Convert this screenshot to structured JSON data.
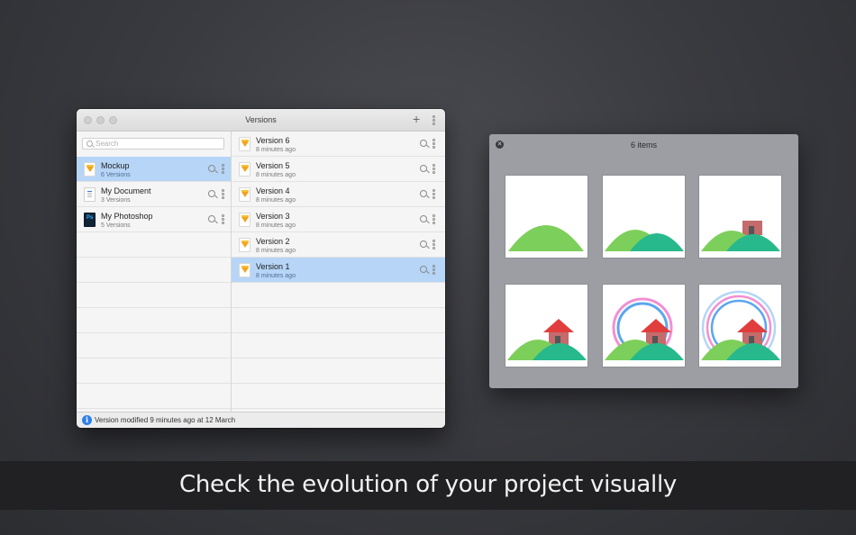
{
  "window": {
    "title": "Versions",
    "add_label": "+",
    "search_placeholder": "Search"
  },
  "documents": [
    {
      "name": "Mockup",
      "versions": "6 Versions",
      "icon": "sketch-file-icon",
      "selected": true
    },
    {
      "name": "My Document",
      "versions": "3 Versions",
      "icon": "word-document-icon",
      "selected": false
    },
    {
      "name": "My Photoshop",
      "versions": "5 Versions",
      "icon": "photoshop-file-icon",
      "selected": false
    }
  ],
  "versions": [
    {
      "name": "Version 6",
      "time": "8 minutes ago",
      "selected": false
    },
    {
      "name": "Version 5",
      "time": "8 minutes ago",
      "selected": false
    },
    {
      "name": "Version 4",
      "time": "8 minutes ago",
      "selected": false
    },
    {
      "name": "Version 3",
      "time": "8 minutes ago",
      "selected": false
    },
    {
      "name": "Version 2",
      "time": "8 minutes ago",
      "selected": false
    },
    {
      "name": "Version 1",
      "time": "8 minutes ago",
      "selected": true
    }
  ],
  "status": {
    "text": "Version modified 9 minutes ago at 12 March",
    "icon": "info-icon"
  },
  "panel": {
    "title": "6 items",
    "close_icon": "close-icon"
  },
  "caption": "Check the evolution of your project visually",
  "colors": {
    "selection": "#b6d5f7",
    "hill_light": "#7dcf5b",
    "hill_dark": "#27b98c",
    "house_roof": "#e23d3d",
    "arc_pink": "#f28fd2",
    "arc_blue": "#5aa7ee"
  }
}
